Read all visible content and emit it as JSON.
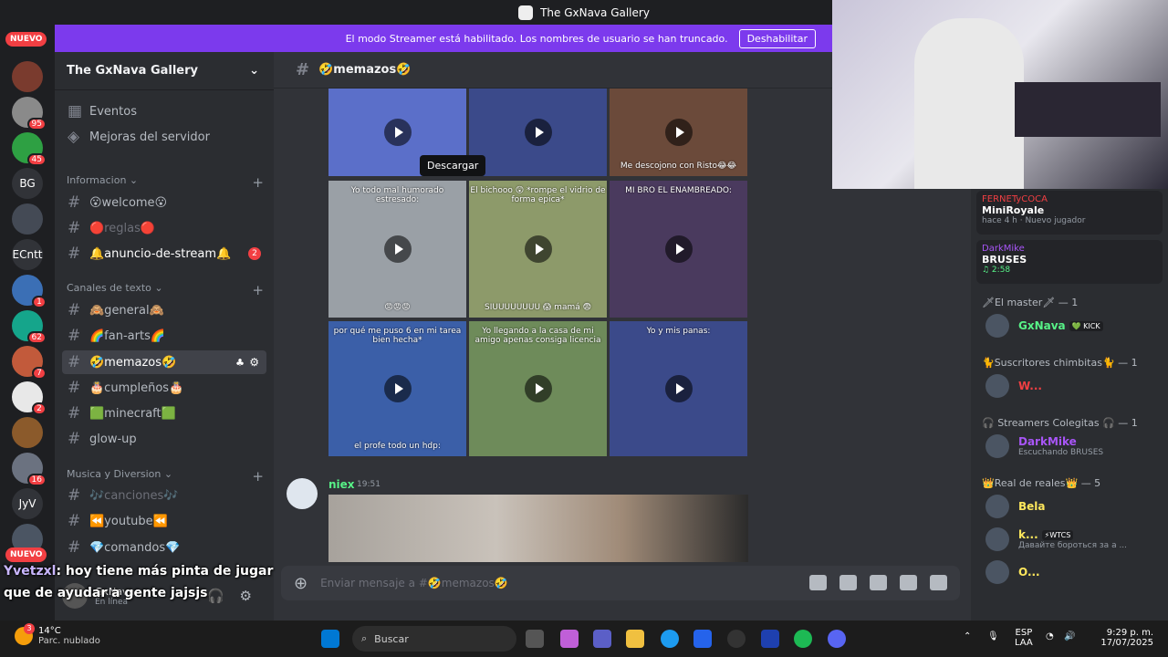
{
  "window": {
    "title": "The GxNava Gallery"
  },
  "banner": {
    "text": "El modo Streamer está habilitado. Los nombres de usuario se han truncado.",
    "button": "Deshabilitar"
  },
  "rail": {
    "new_label": "NUEVO",
    "servers": [
      {
        "label": "",
        "color": "#7a3b2e",
        "badge": ""
      },
      {
        "label": "",
        "color": "#8a8a8a",
        "badge": "95"
      },
      {
        "label": "",
        "color": "#2ea043",
        "badge": "45"
      },
      {
        "label": "BG",
        "color": "#313338",
        "badge": ""
      },
      {
        "label": "",
        "color": "#444a55",
        "badge": ""
      },
      {
        "label": "ECntt",
        "color": "#313338",
        "badge": ""
      },
      {
        "label": "",
        "color": "#3b6fb5",
        "badge": "1"
      },
      {
        "label": "",
        "color": "#15a58b",
        "badge": "62"
      },
      {
        "label": "",
        "color": "#c25a3b",
        "badge": "7"
      },
      {
        "label": "",
        "color": "#e8e8e8",
        "badge": "2"
      },
      {
        "label": "",
        "color": "#8b5a2b",
        "badge": ""
      },
      {
        "label": "",
        "color": "#6b7280",
        "badge": "16"
      },
      {
        "label": "JyV",
        "color": "#313338",
        "badge": ""
      },
      {
        "label": "",
        "color": "#4b5563",
        "badge": ""
      }
    ]
  },
  "sidebar": {
    "server_name": "The GxNava Gallery",
    "top_items": [
      {
        "label": "Eventos"
      },
      {
        "label": "Mejoras del servidor"
      }
    ],
    "categories": {
      "info": "Informacion",
      "text": "Canales de texto",
      "music": "Musica y Diversion"
    },
    "channels": {
      "welcome": "😮welcome😮",
      "reglas": "🔴reglas🔴",
      "anuncio": "🔔anuncio-de-stream🔔",
      "anuncio_badge": "2",
      "general": "🙈general🙈",
      "fanarts": "🌈fan-arts🌈",
      "memazos": "🤣memazos🤣",
      "cumpleanos": "🎂cumpleños🎂",
      "minecraft": "🟩minecraft🟩",
      "glowup": "glow-up",
      "canciones": "🎶canciones🎶",
      "youtube": "⏪youtube⏪",
      "comandos": "💎comandos💎"
    }
  },
  "main": {
    "channel": "🤣memazos🤣",
    "tooltip": "Descargar",
    "tiles": [
      {
        "caption_top": "",
        "caption_bottom": "",
        "color": "#5b6fc9"
      },
      {
        "caption_top": "",
        "caption_bottom": "",
        "color": "#3b4a8a"
      },
      {
        "caption_top": "",
        "caption_bottom": "Me descojono con Risto😂😂",
        "color": "#6b4a3a"
      },
      {
        "caption_top": "Yo todo mal humorado estresado:",
        "caption_bottom": "😡😡😡",
        "color": "#9aa0a6"
      },
      {
        "caption_top": "El bichooo 😲 *rompe el vidrio de forma epica*",
        "caption_bottom": "SIUUUUUUUU 😱 mamá 😨",
        "color": "#8d9a6a"
      },
      {
        "caption_top": "MI BRO EL ENAMBREADO:",
        "caption_bottom": "",
        "color": "#4a3a5e"
      },
      {
        "caption_top": "por qué me puso 6 en mi tarea bien hecha*",
        "caption_bottom": "el profe todo un hdp:",
        "color": "#3b5fa8"
      },
      {
        "caption_top": "Yo llegando a la casa de mi amigo apenas consiga licencia",
        "caption_bottom": "",
        "color": "#6e8b5a"
      },
      {
        "caption_top": "Yo y mis panas:",
        "caption_bottom": "",
        "color": "#3b4a8a"
      }
    ],
    "message": {
      "author": "niex",
      "time": "19:51"
    },
    "composer_placeholder": "Enviar mensaje a #🤣memazos🤣"
  },
  "members": {
    "activity_cards": [
      {
        "name": "FERNETyCOCA",
        "title": "MiniRoyale",
        "sub": "hace 4 h · Nuevo jugador",
        "color": "#f23f43"
      },
      {
        "name": "DarkMike",
        "title": "BRUSES",
        "sub": "♫ 2:58",
        "color": "#a855f7"
      }
    ],
    "groups": [
      {
        "label": "🗡El master🗡 — 1",
        "members": [
          {
            "name": "GxNava",
            "tag": "💚 KICK",
            "sub": "",
            "color": "#57f287"
          }
        ]
      },
      {
        "label": "🐈Suscritores chimbitas🐈 — 1",
        "members": [
          {
            "name": "W...",
            "tag": "",
            "sub": "",
            "color": "#f23f43"
          }
        ]
      },
      {
        "label": "🎧 Streamers Colegitas 🎧 — 1",
        "members": [
          {
            "name": "DarkMike",
            "tag": "",
            "sub": "Escuchando BRUSES",
            "color": "#a855f7"
          }
        ]
      },
      {
        "label": "👑Real de reales👑 — 5",
        "members": [
          {
            "name": "Bela",
            "tag": "",
            "sub": "",
            "color": "#fee75c"
          },
          {
            "name": "k...",
            "tag": "⚡WTCS",
            "sub": "Давайте бороться за а ...",
            "color": "#fee75c"
          },
          {
            "name": "O...",
            "tag": "",
            "sub": "",
            "color": "#fee75c"
          }
        ]
      }
    ]
  },
  "overlay": {
    "chat_user": "Yvetzxl",
    "chat_line1": ": hoy tiene más pinta de jugar",
    "chat_line2": "que de ayudar a gente jajsjs",
    "user_name": "GxNava",
    "user_status": "En línea"
  },
  "taskbar": {
    "weather_temp": "14°C",
    "weather_desc": "Parc. nublado",
    "weather_badge": "3",
    "search": "Buscar",
    "lang": "ESP",
    "lang2": "LAA",
    "time": "9:29 p. m.",
    "date": "17/07/2025"
  }
}
